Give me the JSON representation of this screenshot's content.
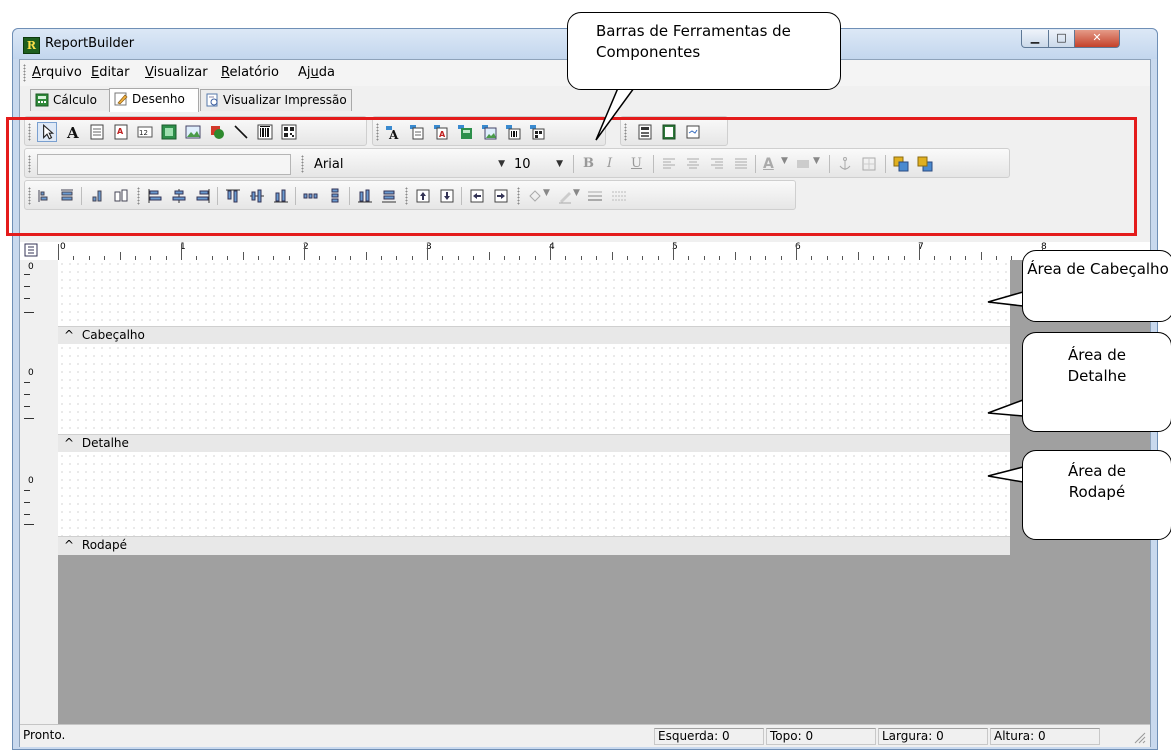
{
  "window": {
    "title": "ReportBuilder",
    "app_icon": "R"
  },
  "menu": [
    "Arquivo",
    "Editar",
    "Visualizar",
    "Relatório",
    "Ajuda"
  ],
  "menu_underline": [
    "A",
    "E",
    "V",
    "R",
    "u"
  ],
  "tabs": [
    {
      "label": "Cálculo",
      "icon": "calc-icon"
    },
    {
      "label": "Desenho",
      "icon": "pencil-icon",
      "active": true
    },
    {
      "label": "Visualizar Impressão",
      "icon": "print-preview-icon"
    }
  ],
  "format": {
    "font": "Arial",
    "size": "10",
    "bold": "B",
    "italic": "I",
    "underline": "U",
    "text_color": "A"
  },
  "ruler": [
    "0",
    "1",
    "2",
    "3",
    "4",
    "5",
    "6",
    "7",
    "8"
  ],
  "bands": [
    {
      "name": "Cabeçalho",
      "ruler_mark": "0"
    },
    {
      "name": "Detalhe",
      "ruler_mark": "0"
    },
    {
      "name": "Rodapé",
      "ruler_mark": "0"
    }
  ],
  "band_caret": "^",
  "status": {
    "message": "Pronto.",
    "left": "Esquerda: 0",
    "top": "Topo: 0",
    "width": "Largura: 0",
    "height": "Altura: 0"
  },
  "callouts": {
    "toolbars": "Barras de Ferramentas de Componentes",
    "header": "Área de Cabeçalho",
    "detail": "Área de Detalhe",
    "footer": "Área de Rodapé"
  },
  "colors": {
    "highlight": "#e41b1b",
    "design_bg": "#a0a0a0"
  }
}
